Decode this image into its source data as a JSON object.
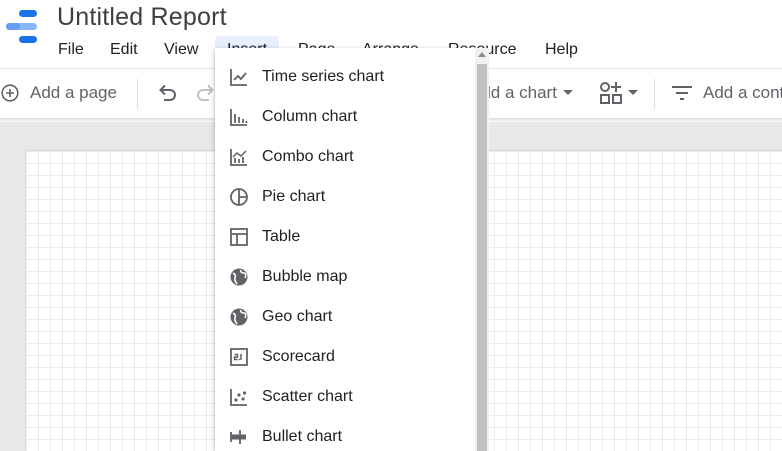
{
  "app": {
    "title": "Untitled Report"
  },
  "menubar": [
    {
      "label": "File"
    },
    {
      "label": "Edit"
    },
    {
      "label": "View"
    },
    {
      "label": "Insert",
      "active": true
    },
    {
      "label": "Page"
    },
    {
      "label": "Arrange"
    },
    {
      "label": "Resource"
    },
    {
      "label": "Help"
    }
  ],
  "toolbar": {
    "add_page_label": "Add a page",
    "add_chart_label": "Add a chart",
    "add_control_label": "Add a control",
    "add_page_icon": "add-circle-icon",
    "undo_icon": "undo-icon",
    "redo_icon": "redo-icon",
    "components_icon": "components-icon",
    "control_icon": "filter-list-icon"
  },
  "insert_menu": {
    "items": [
      {
        "label": "Time series chart",
        "icon": "time-series-chart-icon"
      },
      {
        "label": "Column chart",
        "icon": "column-chart-icon"
      },
      {
        "label": "Combo chart",
        "icon": "combo-chart-icon"
      },
      {
        "label": "Pie chart",
        "icon": "pie-chart-icon"
      },
      {
        "label": "Table",
        "icon": "table-icon"
      },
      {
        "label": "Bubble map",
        "icon": "globe-icon"
      },
      {
        "label": "Geo chart",
        "icon": "globe-icon"
      },
      {
        "label": "Scorecard",
        "icon": "scorecard-icon"
      },
      {
        "label": "Scatter chart",
        "icon": "scatter-chart-icon"
      },
      {
        "label": "Bullet chart",
        "icon": "bullet-chart-icon"
      }
    ]
  },
  "colors": {
    "accent": "#1a73e8",
    "menu_active_bg": "#e8f0fe",
    "icon_grey": "#5f6368",
    "workspace": "#e8e8e8"
  }
}
